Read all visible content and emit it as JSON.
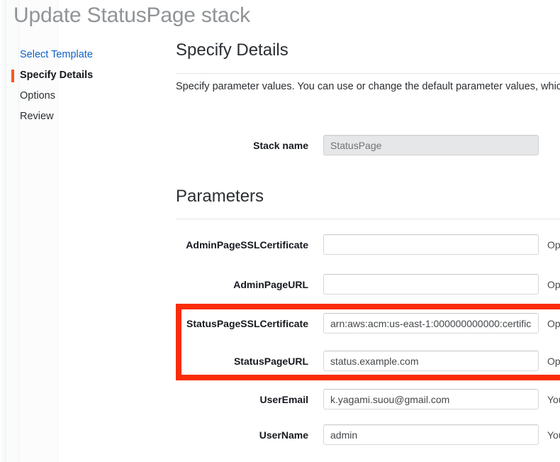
{
  "page": {
    "title": "Update StatusPage stack"
  },
  "wizard": {
    "items": [
      {
        "label": "Select Template",
        "state": "link"
      },
      {
        "label": "Specify Details",
        "state": "active"
      },
      {
        "label": "Options",
        "state": "plain"
      },
      {
        "label": "Review",
        "state": "plain"
      }
    ]
  },
  "details": {
    "heading": "Specify Details",
    "description": "Specify parameter values. You can use or change the default parameter values, whic",
    "stack_name_label": "Stack name",
    "stack_name_value": "StatusPage"
  },
  "parameters": {
    "heading": "Parameters",
    "rows": [
      {
        "label": "AdminPageSSLCertificate",
        "value": "",
        "hint": "Opt",
        "highlighted": false
      },
      {
        "label": "AdminPageURL",
        "value": "",
        "hint": "Opt",
        "highlighted": false
      },
      {
        "label": "StatusPageSSLCertificate",
        "value": "arn:aws:acm:us-east-1:000000000000:certific",
        "hint": "Opt",
        "highlighted": true
      },
      {
        "label": "StatusPageURL",
        "value": "status.example.com",
        "hint": "Opt",
        "highlighted": true
      },
      {
        "label": "UserEmail",
        "value": "k.yagami.suou@gmail.com",
        "hint": "You",
        "highlighted": false
      },
      {
        "label": "UserName",
        "value": "admin",
        "hint": "You",
        "highlighted": false
      }
    ]
  },
  "annotation": {
    "color": "#fa2d08"
  }
}
